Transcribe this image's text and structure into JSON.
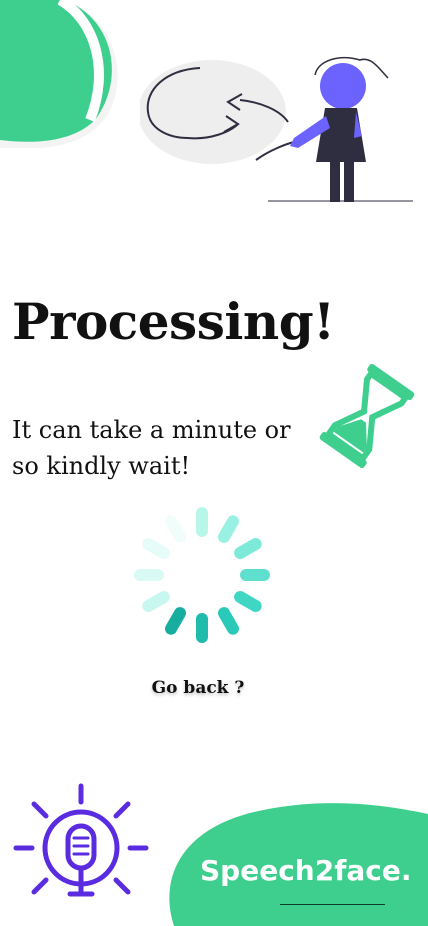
{
  "screen": {
    "title": "Processing!",
    "subtitle": "It can take a minute or so kindly wait!",
    "back_link": "Go back ?",
    "brand": "Speech2face."
  },
  "icons": {
    "illustration": "person-refresh-illustration",
    "hourglass": "hourglass-icon",
    "spinner": "loading-spinner",
    "microphone": "microphone-icon"
  },
  "colors": {
    "accent_green": "#3ecf8e",
    "spinner_teal": "#2bd4c2",
    "person_purple": "#6c63ff",
    "mic_purple": "#5b2be0",
    "text": "#111111"
  }
}
